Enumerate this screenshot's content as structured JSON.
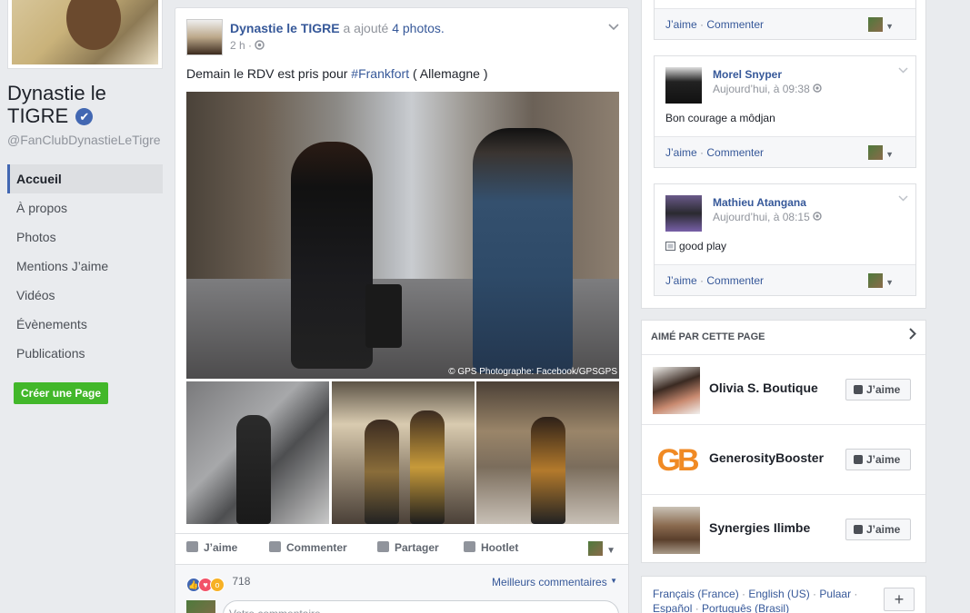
{
  "page": {
    "name": "Dynastie le TIGRE",
    "verified_mark": "✔",
    "handle": "@FanClubDynastieLeTigre",
    "create_page_label": "Créer une Page"
  },
  "nav": {
    "items": [
      {
        "label": "Accueil",
        "active": true
      },
      {
        "label": "À propos"
      },
      {
        "label": "Photos"
      },
      {
        "label": "Mentions J’aime"
      },
      {
        "label": "Vidéos"
      },
      {
        "label": "Évènements"
      },
      {
        "label": "Publications"
      }
    ]
  },
  "post": {
    "author": "Dynastie le TIGRE",
    "action_text": "a ajouté",
    "photos_link": "4 photos.",
    "time": "2 h ·",
    "text_before": "Demain le RDV est pris pour ",
    "hashtag": "#Frankfort",
    "text_after": " ( Allemagne )",
    "photo_credit": "© GPS Photographe: Facebook/GPSGPS",
    "actions": {
      "like": "J’aime",
      "comment": "Commenter",
      "share": "Partager",
      "hootlet": "Hootlet"
    },
    "reaction_count": "718",
    "best_comments": "Meilleurs commentaires",
    "comment_placeholder": "Votre commentaire..."
  },
  "comments": [
    {
      "name": "",
      "time": "",
      "text": "",
      "like": "J’aime",
      "comment": "Commenter"
    },
    {
      "name": "Morel Snyper",
      "time": "Aujourd’hui, à 09:38",
      "text": "Bon courage a môdjan",
      "like": "J’aime",
      "comment": "Commenter"
    },
    {
      "name": "Mathieu Atangana",
      "time": "Aujourd’hui, à 08:15",
      "text": "good play",
      "like": "J’aime",
      "comment": "Commenter"
    }
  ],
  "liked_pages": {
    "title": "AIMÉ PAR CETTE PAGE",
    "items": [
      {
        "name": "Olivia S. Boutique",
        "button": "J’aime"
      },
      {
        "name": "GenerosityBooster",
        "button": "J’aime",
        "logo_text": "GB"
      },
      {
        "name": "Synergies Ilimbe",
        "button": "J’aime"
      }
    ]
  },
  "languages": {
    "line1": [
      "Français (France)",
      "English (US)",
      "Pulaar"
    ],
    "line2": [
      "Español",
      "Português (Brasil)"
    ],
    "more": "+"
  }
}
